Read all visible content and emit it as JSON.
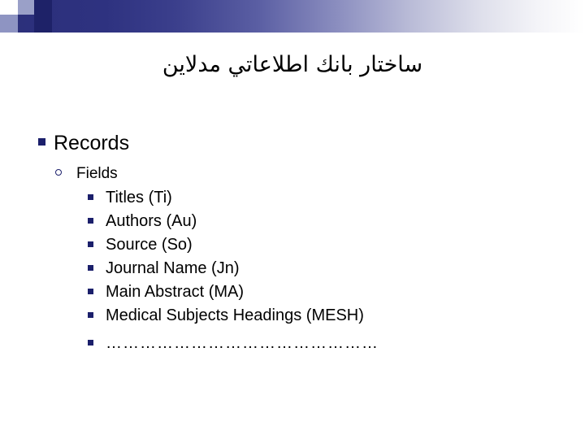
{
  "header": {
    "accent_dark": "#1e2268",
    "accent_mid": "#8e94c2"
  },
  "slide": {
    "title": "ﺳﺎﺧﺘﺎﺭ ﺑﺎﻧﻚ ﺍﻃﻼﻋﺎﺗﻲ ﻣﺪﻻﻳﻦ",
    "outline": {
      "level1_label": "Records",
      "level2_label": "Fields",
      "fields": [
        "Titles (Ti)",
        "Authors (Au)",
        "Source (So)",
        "Journal Name (Jn)",
        "Main Abstract (MA)",
        "Medical Subjects Headings (MESH)",
        "…………………………………………"
      ]
    }
  }
}
